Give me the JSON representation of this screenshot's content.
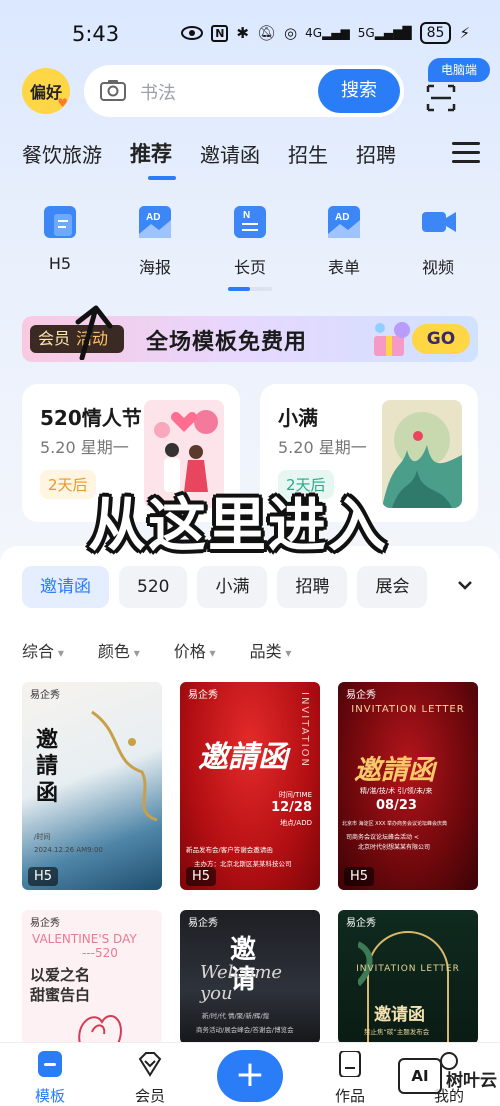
{
  "status_bar": {
    "time": "5:43",
    "network": "4G",
    "network2": "5G",
    "battery": "85"
  },
  "header": {
    "preference_label": "偏好",
    "search_placeholder": "书法",
    "search_button": "搜索",
    "pc_label": "电脑端"
  },
  "categories": [
    "餐饮旅游",
    "推荐",
    "邀请函",
    "招生",
    "招聘"
  ],
  "active_category": "推荐",
  "types": [
    "H5",
    "海报",
    "长页",
    "表单",
    "视频"
  ],
  "banner": {
    "vip": "会员",
    "vip_sub": "活动",
    "text": "全场模板免费用",
    "go": "GO"
  },
  "festivals": [
    {
      "title": "520情人节",
      "date": "5.20  星期一",
      "badge": "2天后"
    },
    {
      "title": "小满",
      "date": "5.20  星期一",
      "badge": "2天后"
    }
  ],
  "overlay_text": "从这里进入",
  "chips": [
    "邀请函",
    "520",
    "小满",
    "招聘",
    "展会"
  ],
  "filters": [
    "综合",
    "颜色",
    "价格",
    "品类"
  ],
  "templates": [
    {
      "logo": "易企秀",
      "title": "邀\n請\n函",
      "badge": "H5",
      "date": "2024.12.26 AM9:00",
      "time_label": "/时间"
    },
    {
      "logo": "易企秀",
      "title": "邀請函",
      "badge": "H5",
      "date": "12/28",
      "time_label": "时间/TIME",
      "place_label": "地点/ADD",
      "sub": "新品发布会/客户答谢会邀请函",
      "host": "主办方：北京北斯区某某科技公司",
      "side": "INVITATION"
    },
    {
      "logo": "易企秀",
      "title": "邀請函",
      "badge": "H5",
      "header": "INVITATION LETTER",
      "sub": "精/湛/技/术  引/领/未/来",
      "date": "08/23",
      "line1": "北京市 海淀区 XXX 举办商务会议论坛峰会庆典",
      "line2": "司商务会议论坛峰会活动 <",
      "line3": "北京时代创想某某有限公司"
    },
    {
      "logo": "易企秀",
      "header": "VALENTINE'S DAY",
      "header2": "---520",
      "title": "以爱之名\n甜蜜告白"
    },
    {
      "logo": "易企秀",
      "title": "邀\n请",
      "script": "Welcome you",
      "sub": "新/时/代  情/聚/新/辉/煌",
      "line1": "商务活动/展会峰会/答谢会/博览会"
    },
    {
      "logo": "易企秀",
      "header": "INVITATION LETTER",
      "title": "邀请函",
      "sub": "禁止焦“碳”主题发布会"
    }
  ],
  "nav": {
    "templates": "模板",
    "vip": "会员",
    "works": "作品",
    "mine": "我的"
  },
  "watermark": {
    "box": "AI",
    "text": "树叶云"
  },
  "colors": {
    "accent": "#2b7cf7",
    "banner_go": "#ffd644",
    "badge_orange": "#e69a2b",
    "badge_teal": "#2aa88a"
  }
}
